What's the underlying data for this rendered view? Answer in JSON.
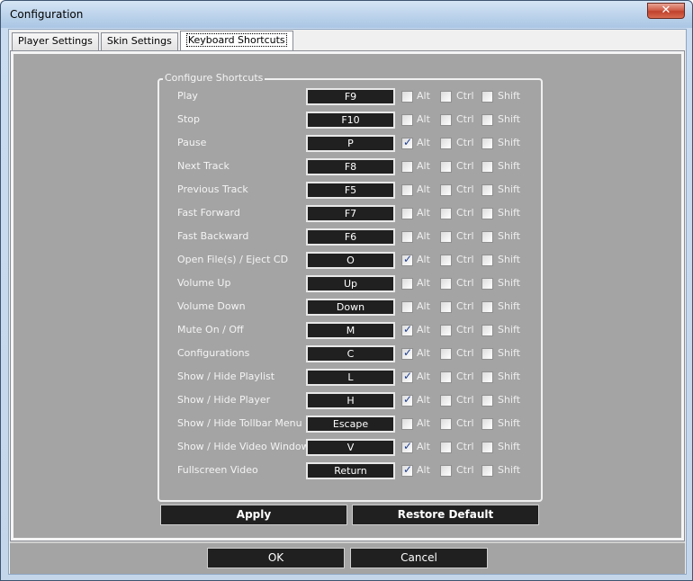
{
  "window": {
    "title": "Configuration",
    "close_glyph": "✕"
  },
  "tabs": [
    {
      "label": "Player Settings",
      "active": false
    },
    {
      "label": "Skin Settings",
      "active": false
    },
    {
      "label": "Keyboard Shortcuts",
      "active": true
    }
  ],
  "group": {
    "title": "Configure Shortcuts"
  },
  "modifier_labels": {
    "alt": "Alt",
    "ctrl": "Ctrl",
    "shift": "Shift"
  },
  "shortcuts": [
    {
      "action": "Play",
      "key": "F9",
      "alt": false,
      "ctrl": false,
      "shift": false
    },
    {
      "action": "Stop",
      "key": "F10",
      "alt": false,
      "ctrl": false,
      "shift": false
    },
    {
      "action": "Pause",
      "key": "P",
      "alt": true,
      "ctrl": false,
      "shift": false
    },
    {
      "action": "Next Track",
      "key": "F8",
      "alt": false,
      "ctrl": false,
      "shift": false
    },
    {
      "action": "Previous Track",
      "key": "F5",
      "alt": false,
      "ctrl": false,
      "shift": false
    },
    {
      "action": "Fast Forward",
      "key": "F7",
      "alt": false,
      "ctrl": false,
      "shift": false
    },
    {
      "action": "Fast Backward",
      "key": "F6",
      "alt": false,
      "ctrl": false,
      "shift": false
    },
    {
      "action": "Open File(s) / Eject CD",
      "key": "O",
      "alt": true,
      "ctrl": false,
      "shift": false
    },
    {
      "action": "Volume Up",
      "key": "Up",
      "alt": false,
      "ctrl": false,
      "shift": false
    },
    {
      "action": "Volume Down",
      "key": "Down",
      "alt": false,
      "ctrl": false,
      "shift": false
    },
    {
      "action": "Mute On / Off",
      "key": "M",
      "alt": true,
      "ctrl": false,
      "shift": false
    },
    {
      "action": "Configurations",
      "key": "C",
      "alt": true,
      "ctrl": false,
      "shift": false
    },
    {
      "action": "Show / Hide Playlist",
      "key": "L",
      "alt": true,
      "ctrl": false,
      "shift": false
    },
    {
      "action": "Show / Hide Player",
      "key": "H",
      "alt": true,
      "ctrl": false,
      "shift": false
    },
    {
      "action": "Show / Hide Tollbar Menu",
      "key": "Escape",
      "alt": false,
      "ctrl": false,
      "shift": false
    },
    {
      "action": "Show / Hide Video Window",
      "key": "V",
      "alt": true,
      "ctrl": false,
      "shift": false
    },
    {
      "action": "Fullscreen Video",
      "key": "Return",
      "alt": true,
      "ctrl": false,
      "shift": false
    }
  ],
  "buttons": {
    "apply": "Apply",
    "restore_default": "Restore Default",
    "ok": "OK",
    "cancel": "Cancel"
  }
}
